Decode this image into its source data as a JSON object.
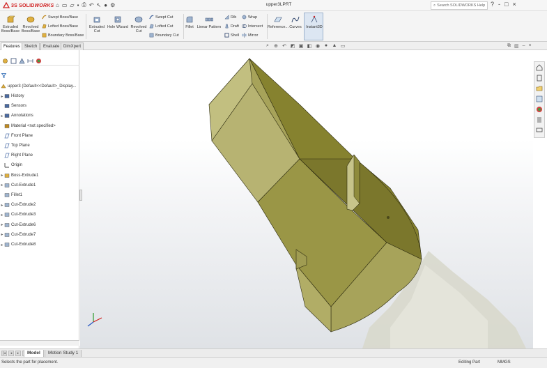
{
  "titlebar": {
    "brand_bold": "3S SOLID",
    "brand_italic": "WORKS",
    "document_title": "upper3LPRT",
    "search_placeholder": "Search SOLIDWORKS Help",
    "controls": {
      "help": "?",
      "minimize": "-",
      "maximize": "□",
      "close": "×"
    }
  },
  "ribbon": {
    "extruded_boss": "Extruded Boss/Base",
    "revolved_boss": "Revolved Boss/Base",
    "swept_boss": "Swept Boss/Base",
    "lofted_boss": "Lofted Boss/Base",
    "boundary_boss": "Boundary Boss/Base",
    "extruded_cut": "Extruded Cut",
    "hole_wizard": "Hole Wizard",
    "revolved_cut": "Revolved Cut",
    "swept_cut": "Swept Cut",
    "lofted_cut": "Lofted Cut",
    "boundary_cut": "Boundary Cut",
    "fillet": "Fillet",
    "linear_pattern": "Linear Pattern",
    "rib": "Rib",
    "draft": "Draft",
    "shell": "Shell",
    "wrap": "Wrap",
    "intersect": "Intersect",
    "mirror": "Mirror",
    "reference_geometry": "Reference...",
    "curves": "Curves",
    "instant3d": "Instant3D"
  },
  "tabs": [
    "Features",
    "Sketch",
    "Evaluate",
    "DimXpert"
  ],
  "tree": {
    "root": "upper3 (Default<<Default>_Display...",
    "items": [
      {
        "label": "History",
        "icon": "history-icon",
        "expand": "▸"
      },
      {
        "label": "Sensors",
        "icon": "sensor-icon",
        "expand": ""
      },
      {
        "label": "Annotations",
        "icon": "annotations-icon",
        "expand": "▸"
      },
      {
        "label": "Material <not specified>",
        "icon": "material-icon",
        "expand": ""
      },
      {
        "label": "Front Plane",
        "icon": "plane-icon",
        "expand": ""
      },
      {
        "label": "Top Plane",
        "icon": "plane-icon",
        "expand": ""
      },
      {
        "label": "Right Plane",
        "icon": "plane-icon",
        "expand": ""
      },
      {
        "label": "Origin",
        "icon": "origin-icon",
        "expand": ""
      },
      {
        "label": "Boss-Extrude1",
        "icon": "boss-extrude-icon",
        "expand": "▸"
      },
      {
        "label": "Cut-Extrude1",
        "icon": "cut-extrude-icon",
        "expand": "▸"
      },
      {
        "label": "Fillet1",
        "icon": "fillet-icon",
        "expand": ""
      },
      {
        "label": "Cut-Extrude2",
        "icon": "cut-extrude-icon",
        "expand": "▸"
      },
      {
        "label": "Cut-Extrude3",
        "icon": "cut-extrude-icon",
        "expand": "▸"
      },
      {
        "label": "Cut-Extrude6",
        "icon": "cut-extrude-icon",
        "expand": "▸"
      },
      {
        "label": "Cut-Extrude7",
        "icon": "cut-extrude-icon",
        "expand": "▸"
      },
      {
        "label": "Cut-Extrude8",
        "icon": "cut-extrude-icon",
        "expand": "▸"
      }
    ]
  },
  "bottom_tabs": [
    "Model",
    "Motion Study 1"
  ],
  "status": {
    "message": "Selects the part for placement.",
    "mode": "Editing Part",
    "units": "MMGS"
  },
  "colors": {
    "part_top": "#a7a35a",
    "part_side": "#86822f",
    "part_front": "#c2bf80",
    "part_dark": "#6e6b25",
    "shadow": "#cfcfc4",
    "accent": "#d02020"
  }
}
